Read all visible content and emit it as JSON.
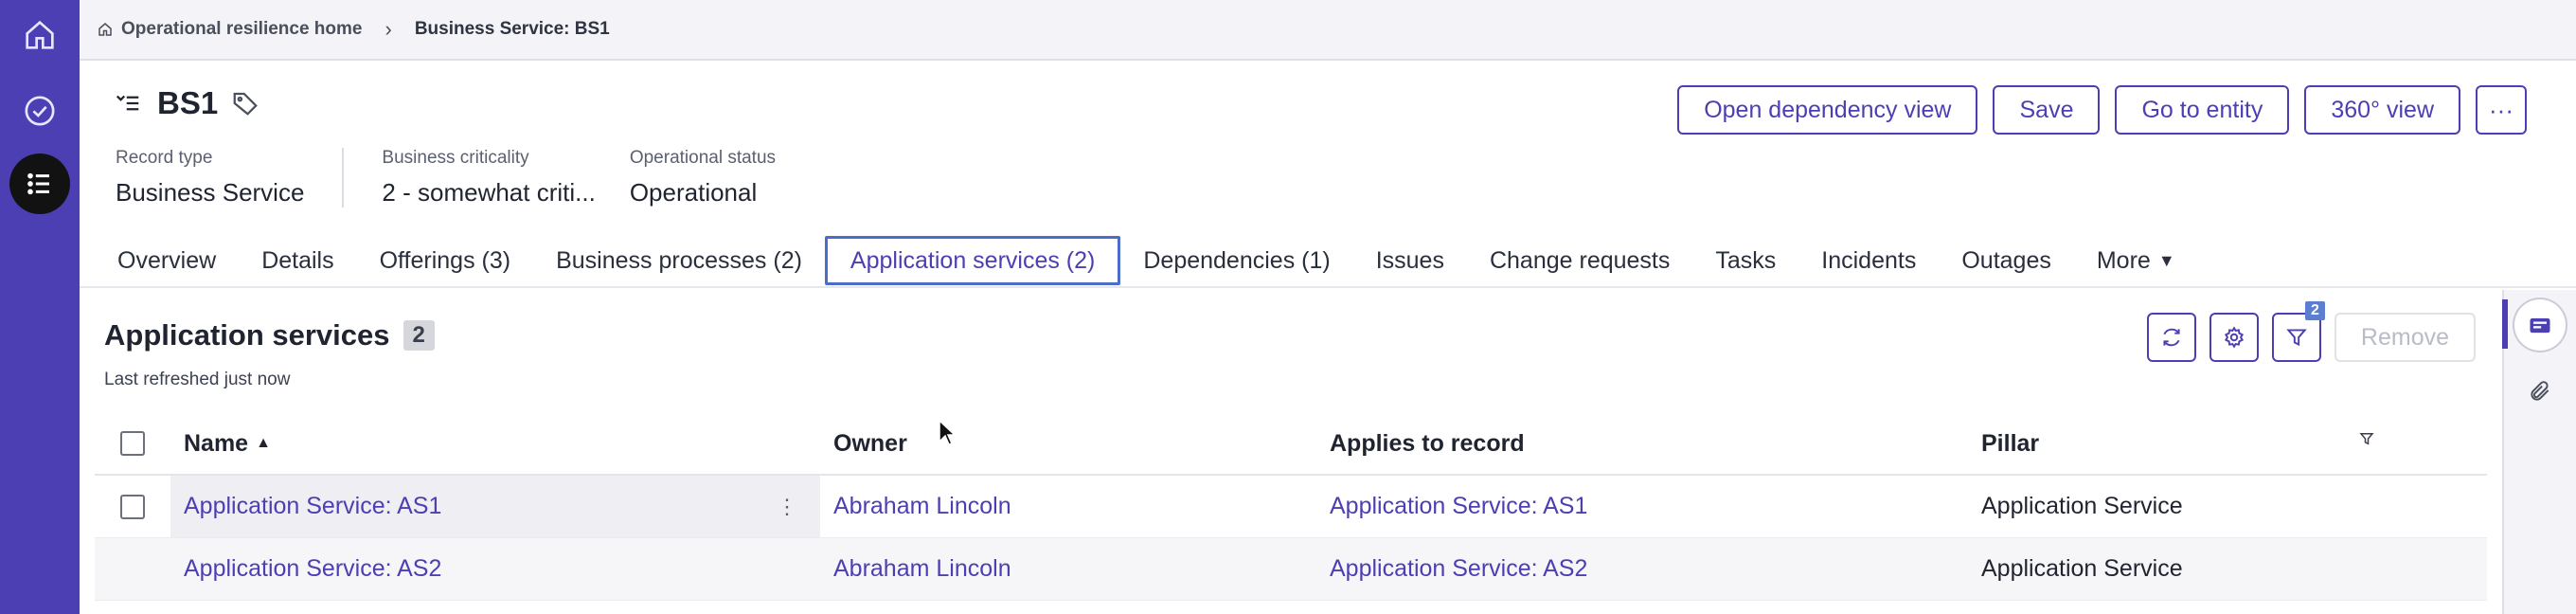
{
  "breadcrumb": {
    "home": "Operational resilience home",
    "current": "Business Service: BS1"
  },
  "record": {
    "title": "BS1",
    "meta": [
      {
        "label": "Record type",
        "value": "Business Service"
      },
      {
        "label": "Business criticality",
        "value": "2 - somewhat criti..."
      },
      {
        "label": "Operational status",
        "value": "Operational"
      }
    ]
  },
  "actions": {
    "open_dependency": "Open dependency view",
    "save": "Save",
    "go_to_entity": "Go to entity",
    "view_360": "360° view",
    "more": "···"
  },
  "tabs": [
    {
      "label": "Overview"
    },
    {
      "label": "Details"
    },
    {
      "label": "Offerings (3)"
    },
    {
      "label": "Business processes (2)"
    },
    {
      "label": "Application services (2)",
      "selected": true
    },
    {
      "label": "Dependencies (1)"
    },
    {
      "label": "Issues"
    },
    {
      "label": "Change requests"
    },
    {
      "label": "Tasks"
    },
    {
      "label": "Incidents"
    },
    {
      "label": "Outages"
    },
    {
      "label": "More"
    }
  ],
  "section": {
    "title": "Application services",
    "count": "2",
    "refreshed": "Last refreshed just now",
    "filter_count": "2",
    "remove_label": "Remove"
  },
  "table": {
    "headers": {
      "name": "Name",
      "owner": "Owner",
      "applies": "Applies to record",
      "pillar": "Pillar"
    },
    "rows": [
      {
        "name": "Application Service: AS1",
        "owner": "Abraham Lincoln",
        "applies": "Application Service: AS1",
        "pillar": "Application Service"
      },
      {
        "name": "Application Service: AS2",
        "owner": "Abraham Lincoln",
        "applies": "Application Service: AS2",
        "pillar": "Application Service"
      }
    ]
  },
  "colors": {
    "rail": "#4b3fb3",
    "accent": "#4b3fb3",
    "tab_selected_border": "#4b6cc9"
  }
}
